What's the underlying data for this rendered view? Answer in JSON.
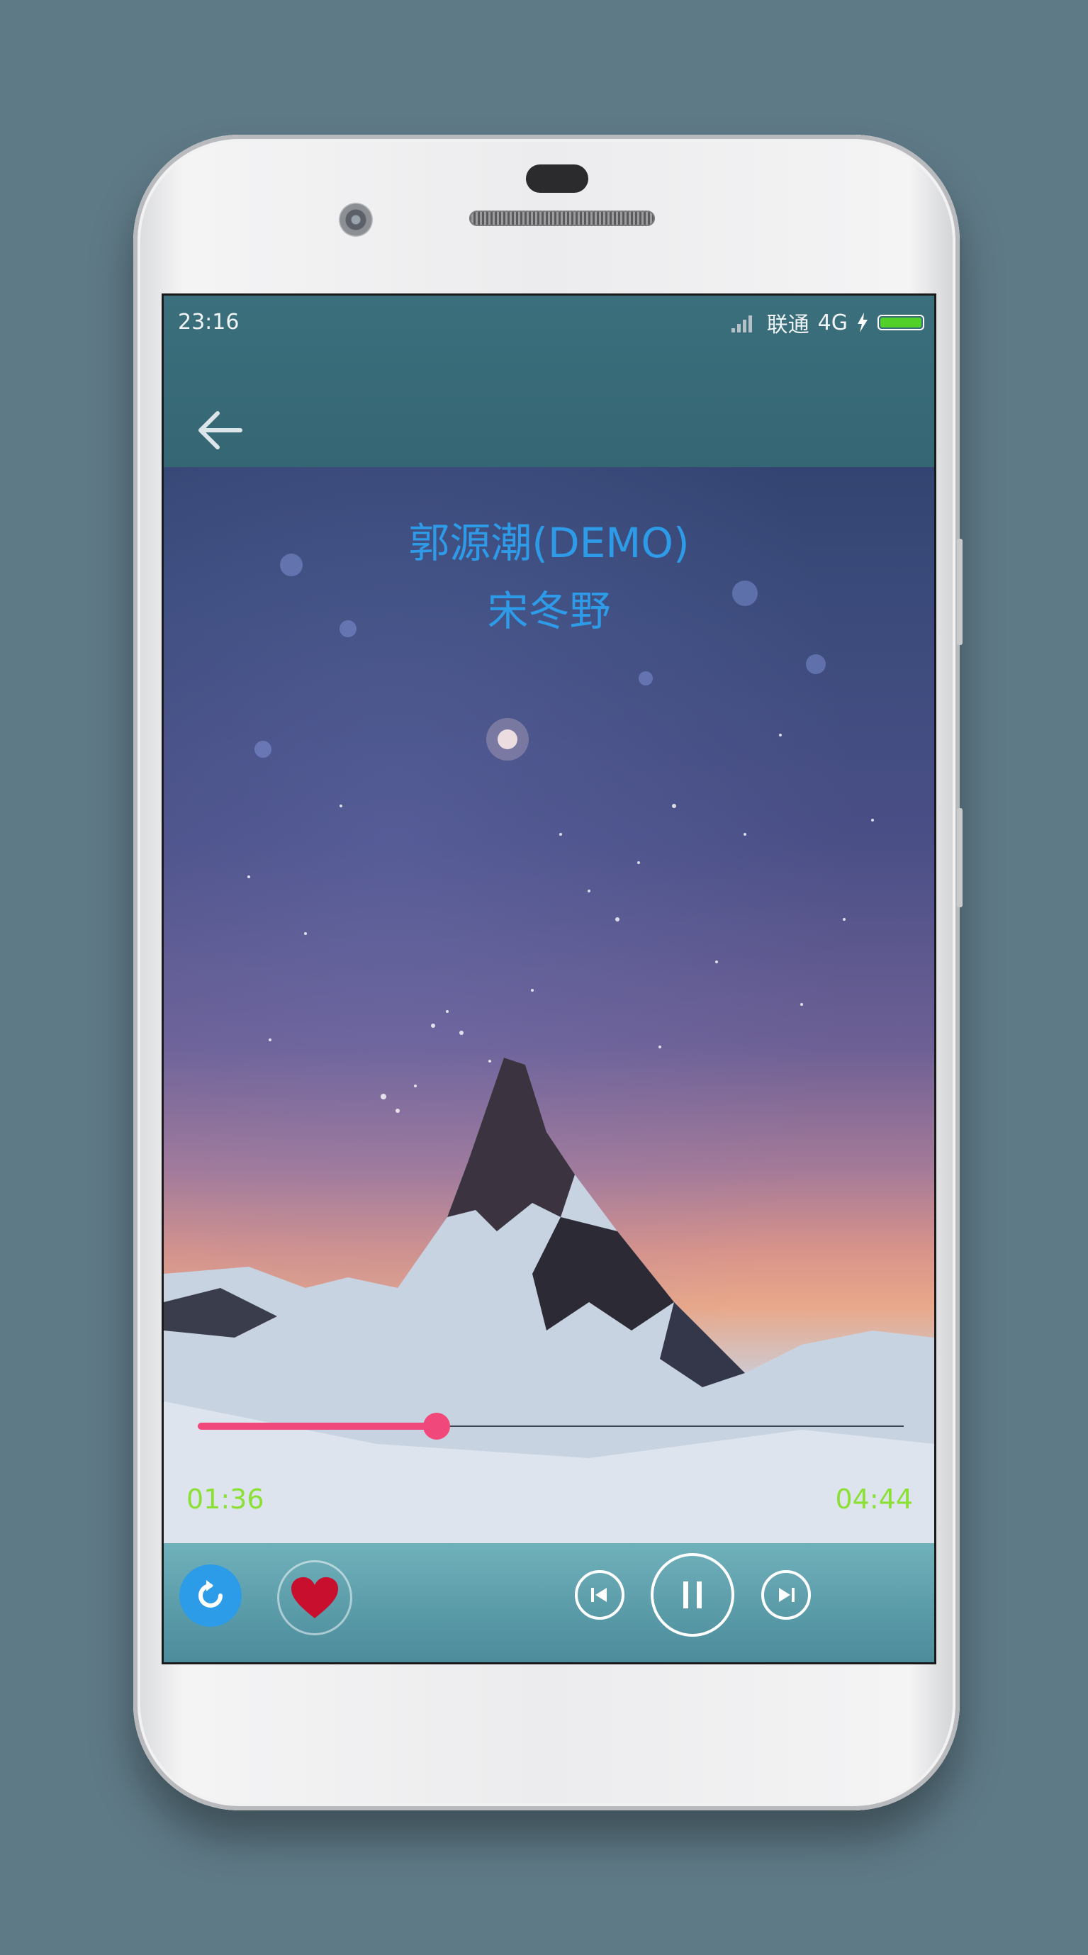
{
  "status_bar": {
    "time": "23:16",
    "carrier": "联通",
    "network": "4G"
  },
  "track": {
    "title": "郭源潮(DEMO)",
    "artist": "宋冬野"
  },
  "playback": {
    "elapsed": "01:36",
    "duration": "04:44",
    "progress": 0.338
  },
  "icons": {
    "back": "arrow-left-icon",
    "repeat": "repeat-icon",
    "favorite": "heart-icon",
    "previous": "skip-previous-icon",
    "pause": "pause-icon",
    "next": "skip-next-icon"
  },
  "colors": {
    "title": "#2e9be8",
    "progress": "#f0487a",
    "time": "#8be034",
    "heart": "#c8102e",
    "repeat": "#2c9be8"
  }
}
